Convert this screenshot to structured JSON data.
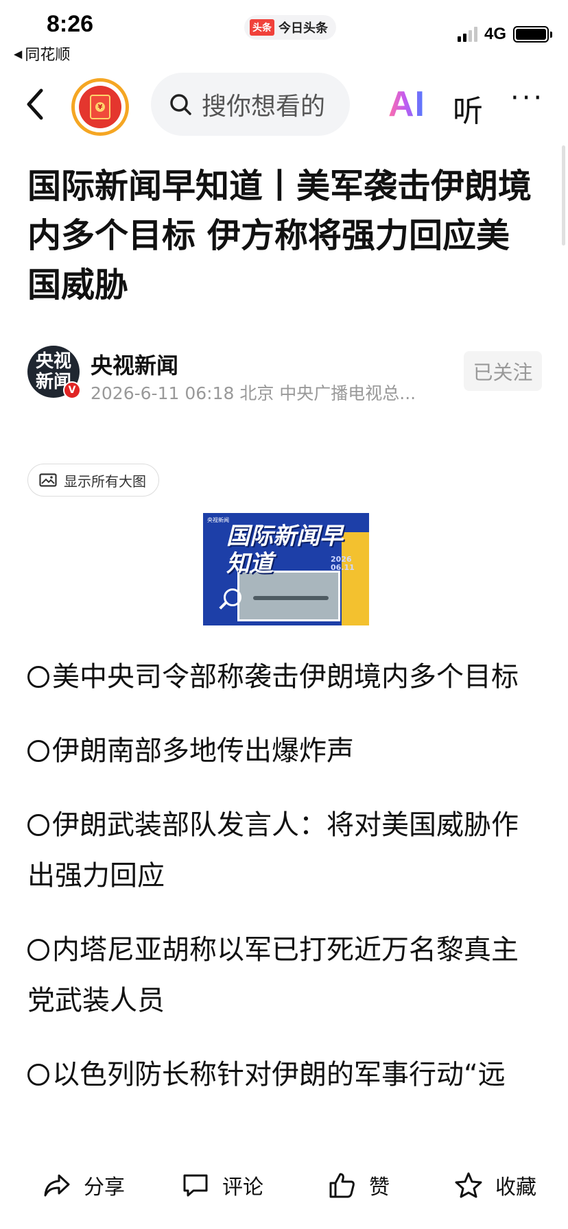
{
  "status_bar": {
    "time": "8:26",
    "back_app": "同花顺",
    "app_logo": "头条",
    "app_name": "今日头条",
    "network": "4G"
  },
  "nav": {
    "search_placeholder": "搜你想看的",
    "ai_label": "AI",
    "listen_label": "听",
    "more_label": "···",
    "activity_icon": "red-envelope-icon"
  },
  "article": {
    "title": "国际新闻早知道丨美军袭击伊朗境内多个目标 伊方称将强力回应美国威胁",
    "author": {
      "avatar_text": "央视新闻",
      "verified_mark": "V",
      "name": "央视新闻",
      "meta": "2026-6-11 06:18 北京 中央广播电视总...",
      "follow_label": "已关注"
    },
    "show_images_label": "显示所有大图",
    "cover": {
      "source_label": "央视新闻",
      "title": "国际新闻早知道",
      "date": "2026 06.11"
    },
    "bullets": [
      "美中央司令部称袭击伊朗境内多个目标",
      "伊朗南部多地传出爆炸声",
      "伊朗武装部队发言人：将对美国威胁作出强力回应",
      "内塔尼亚胡称以军已打死近万名黎真主党武装人员",
      "以色列防长称针对伊朗的军事行动“远"
    ]
  },
  "bottom_bar": {
    "share": "分享",
    "comment": "评论",
    "like": "赞",
    "favorite": "收藏"
  },
  "colors": {
    "accent_red": "#e02424",
    "ring_orange": "#f5a623",
    "cover_blue": "#1d3fa8"
  }
}
